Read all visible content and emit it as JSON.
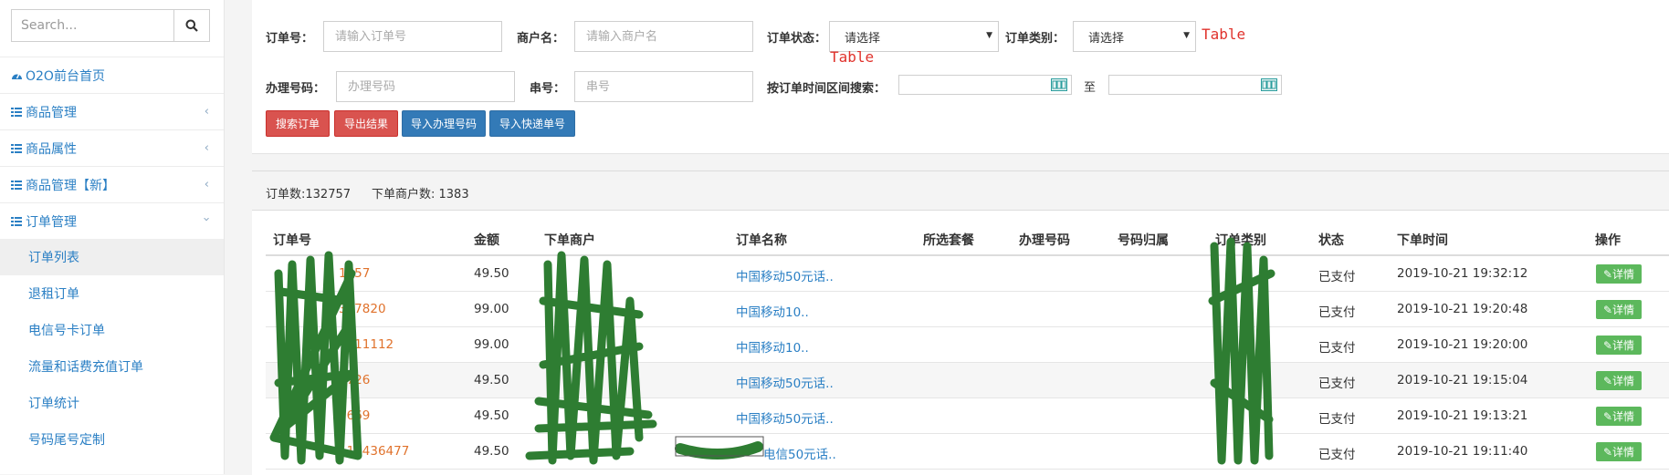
{
  "sidebar": {
    "search_placeholder": "Search...",
    "items": [
      {
        "label": "O2O前台首页",
        "icon": "dashboard-icon",
        "expandable": false
      },
      {
        "label": "商品管理",
        "icon": "list-icon",
        "expandable": true
      },
      {
        "label": "商品属性",
        "icon": "list-icon",
        "expandable": true
      },
      {
        "label": "商品管理【新】",
        "icon": "list-icon",
        "expandable": true
      },
      {
        "label": "订单管理",
        "icon": "list-icon",
        "expandable": true,
        "expanded": true
      }
    ],
    "sub_items": [
      {
        "label": "订单列表",
        "active": true
      },
      {
        "label": "退租订单"
      },
      {
        "label": "电信号卡订单"
      },
      {
        "label": "流量和话费充值订单"
      },
      {
        "label": "订单统计"
      },
      {
        "label": "号码尾号定制"
      }
    ]
  },
  "filters": {
    "order_no": {
      "label": "订单号：",
      "placeholder": "请输入订单号"
    },
    "merchant": {
      "label": "商户名：",
      "placeholder": "请输入商户名"
    },
    "status": {
      "label": "订单状态：",
      "value": "请选择"
    },
    "category": {
      "label": "订单类别：",
      "value": "请选择"
    },
    "handle_no": {
      "label": "办理号码：",
      "placeholder": "办理号码"
    },
    "serial": {
      "label": "串号：",
      "placeholder": "串号"
    },
    "time_range": {
      "label": "按订单时间区间搜索：",
      "to": "至"
    },
    "overlay_text_1": "Table",
    "overlay_text_2": "Table"
  },
  "buttons": {
    "search": "搜索订单",
    "export": "导出结果",
    "import_handle": "导入办理号码",
    "import_express": "导入快递单号"
  },
  "summary": {
    "order_count": "订单数:132757",
    "merchant_count": "下单商户数: 1383"
  },
  "table": {
    "headers": [
      "订单号",
      "金额",
      "下单商户",
      "订单名称",
      "所选套餐",
      "办理号码",
      "号码归属",
      "订单类别",
      "状态",
      "下单时间",
      "操作"
    ],
    "rows": [
      {
        "order_no": "1857",
        "amount": "49.50",
        "name": "中国移动50元话..",
        "status": "已支付",
        "time": "2019-10-21 19:32:12",
        "action": "详情"
      },
      {
        "order_no": "337820",
        "amount": "99.00",
        "name": "中国移动10..",
        "status": "已支付",
        "time": "2019-10-21 19:20:48",
        "action": "详情"
      },
      {
        "order_no": "7211112",
        "amount": "99.00",
        "name": "中国移动10..",
        "status": "已支付",
        "time": "2019-10-21 19:20:00",
        "action": "详情"
      },
      {
        "order_no": "9726",
        "amount": "49.50",
        "name": "中国移动50元话..",
        "status": "已支付",
        "time": "2019-10-21 19:15:04",
        "action": "详情"
      },
      {
        "order_no": "2669",
        "amount": "49.50",
        "name": "中国移动50元话..",
        "status": "已支付",
        "time": "2019-10-21 19:13:21",
        "action": "详情"
      },
      {
        "order_no": "114436477",
        "amount": "49.50",
        "name": "电信50元话..",
        "status": "已支付",
        "time": "2019-10-21 19:11:40",
        "action": "详情"
      }
    ]
  },
  "colors": {
    "link_blue": "#2a7fc4",
    "order_orange": "#e0722c",
    "danger": "#d9534f",
    "primary": "#337ab7",
    "success": "#5cb85c",
    "scribble_green": "#2e7d32"
  }
}
